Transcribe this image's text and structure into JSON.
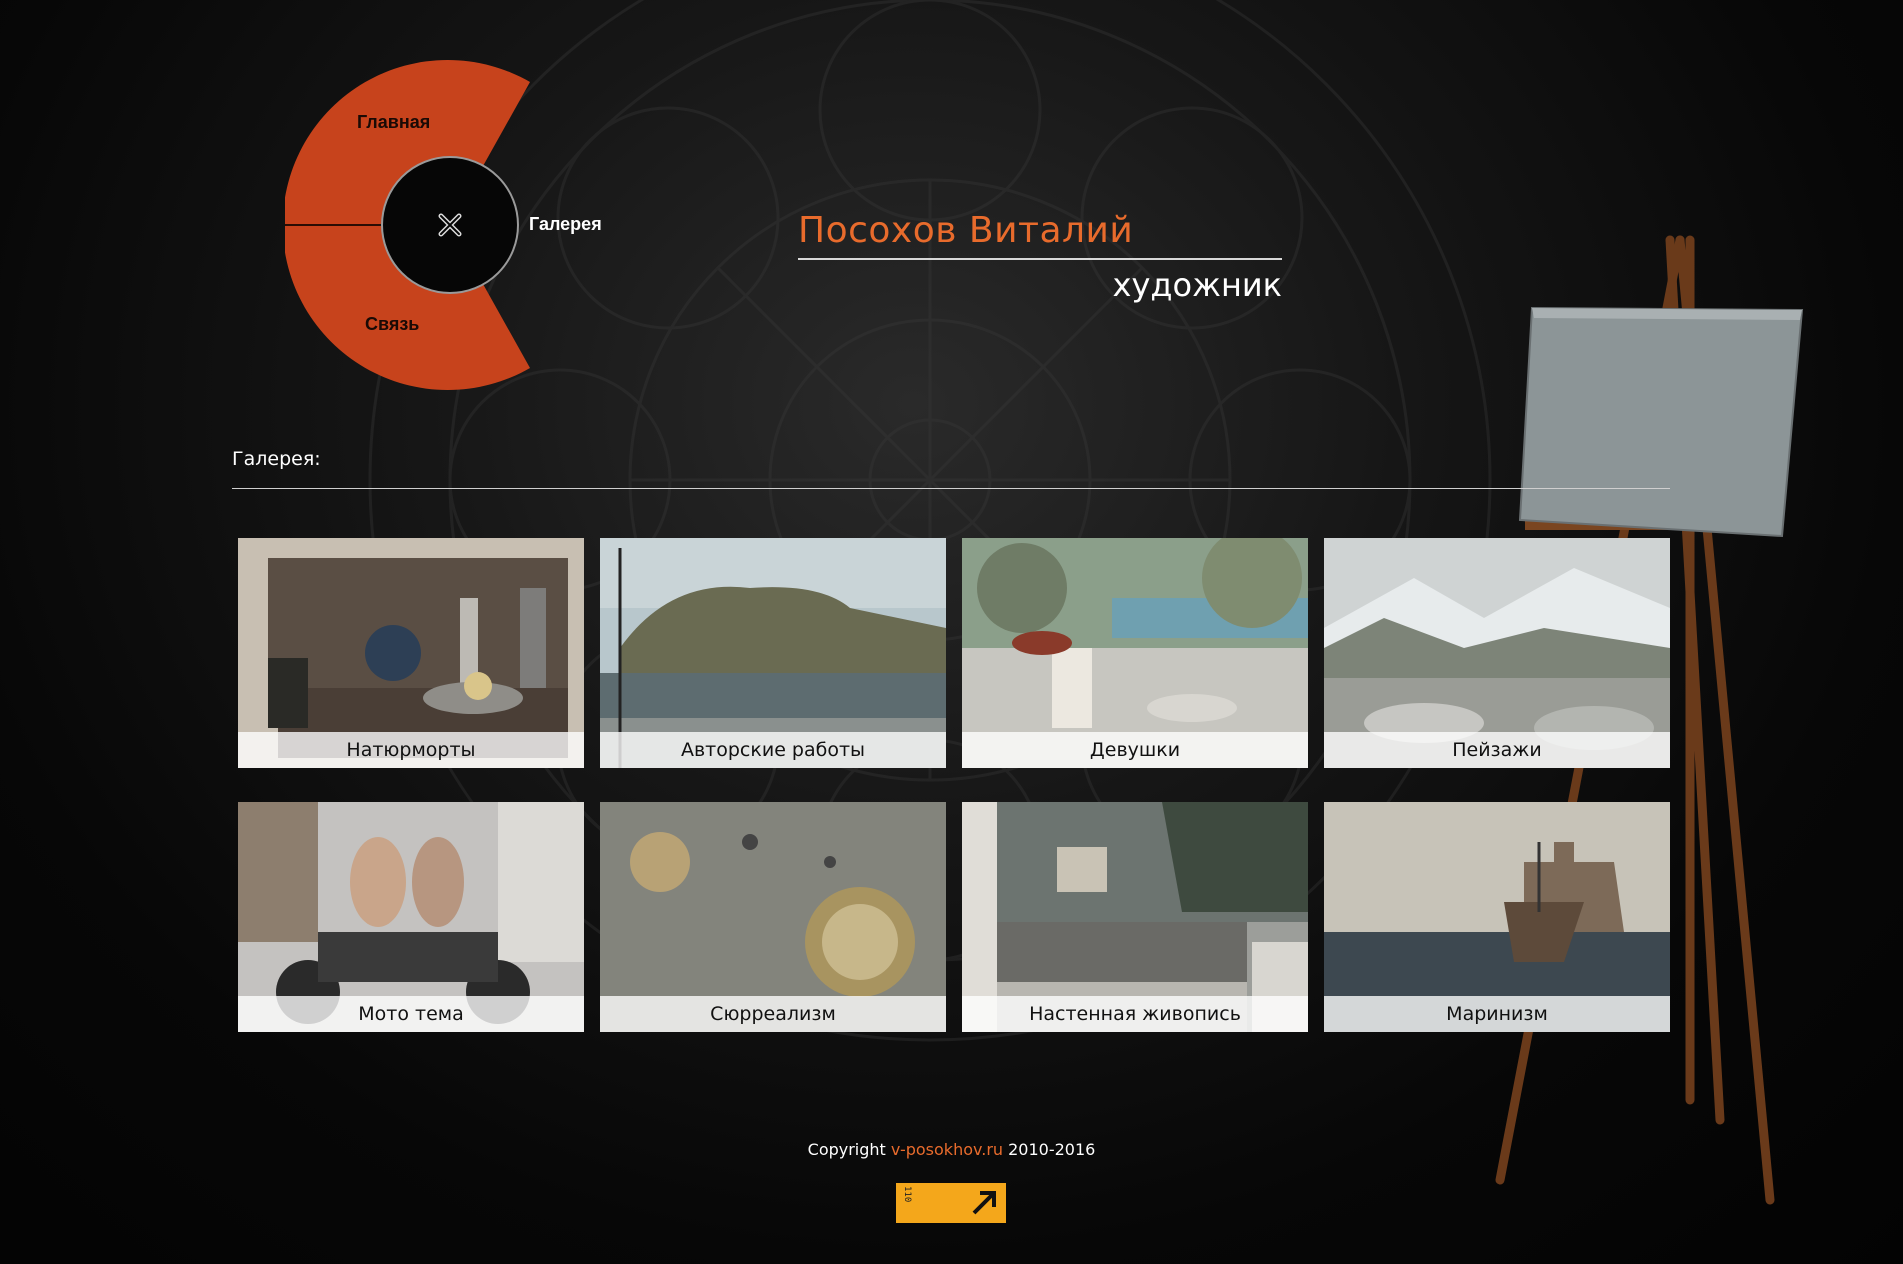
{
  "menu": {
    "home_label": "Главная",
    "gallery_label": "Галерея",
    "contact_label": "Связь",
    "accent_color": "#c7431c"
  },
  "header": {
    "name": "Посохов Виталий",
    "role": "художник",
    "name_color": "#e86b2c"
  },
  "gallery": {
    "title": "Галерея:",
    "tiles": [
      {
        "label": "Натюрморты"
      },
      {
        "label": "Авторские работы"
      },
      {
        "label": "Девушки"
      },
      {
        "label": "Пейзажи"
      },
      {
        "label": "Мото тема"
      },
      {
        "label": "Сюрреализм"
      },
      {
        "label": "Настенная живопись"
      },
      {
        "label": "Маринизм"
      }
    ]
  },
  "footer": {
    "copyright_prefix": "Copyright",
    "site": "v-posokhov.ru",
    "years": "2010-2016",
    "counter_digits": "110"
  }
}
